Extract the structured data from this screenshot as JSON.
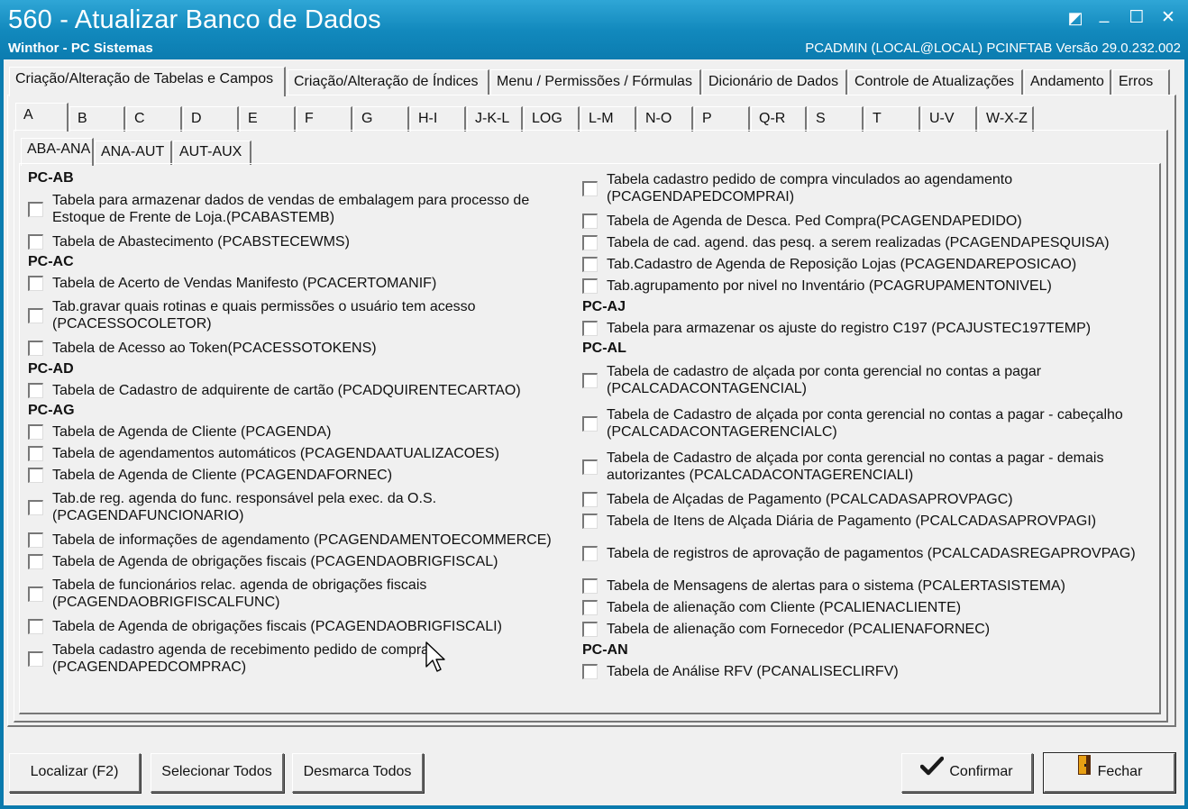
{
  "window": {
    "title": "560 - Atualizar Banco de Dados",
    "subtitle": "Winthor - PC Sistemas",
    "info": "PCADMIN (LOCAL@LOCAL)  PCINFTAB  Versão  29.0.232.002",
    "btn_min": "_",
    "btn_max": "☐",
    "btn_close": "✕",
    "btn_restore": "◩"
  },
  "outer_tabs": [
    "Criação/Alteração de Tabelas e Campos",
    "Criação/Alteração de Índices",
    "Menu / Permissões / Fórmulas",
    "Dicionário de Dados",
    "Controle de Atualizações",
    "Andamento",
    "Erros"
  ],
  "letter_tabs": [
    "A",
    "B",
    "C",
    "D",
    "E",
    "F",
    "G",
    "H-I",
    "J-K-L",
    "LOG",
    "L-M",
    "N-O",
    "P",
    "Q-R",
    "S",
    "T",
    "U-V",
    "W-X-Z"
  ],
  "sub_tabs": [
    "ABA-ANA",
    "ANA-AUT",
    "AUT-AUX"
  ],
  "left": {
    "g_ab": "PC-AB",
    "i1a": "Tabela para armazenar dados de vendas de embalagem para processo de",
    "i1b": "Estoque de Frente de Loja.(PCABASTEMB)",
    "i2": "Tabela de Abastecimento (PCABSTECEWMS)",
    "g_ac": "PC-AC",
    "i3": "Tabela de Acerto de Vendas Manifesto (PCACERTOMANIF)",
    "i4a": "Tab.gravar quais rotinas e quais permissões o usuário tem acesso",
    "i4b": "(PCACESSOCOLETOR)",
    "i5": "Tabela de Acesso ao Token(PCACESSOTOKENS)",
    "g_ad": "PC-AD",
    "i6": "Tabela de Cadastro de adquirente de cartão (PCADQUIRENTECARTAO)",
    "g_ag": "PC-AG",
    "i7": "Tabela  de Agenda de Cliente (PCAGENDA)",
    "i8": "Tabela de agendamentos automáticos (PCAGENDAATUALIZACOES)",
    "i9": "Tabela  de Agenda de Cliente (PCAGENDAFORNEC)",
    "i10a": "Tab.de reg. agenda do func. responsável pela exec. da O.S.",
    "i10b": "(PCAGENDAFUNCIONARIO)",
    "i11": "Tabela de informações de agendamento (PCAGENDAMENTOECOMMERCE)",
    "i12": "Tabela de Agenda de obrigações fiscais (PCAGENDAOBRIGFISCAL)",
    "i13a": "Tabela de funcionários relac. agenda de obrigações fiscais",
    "i13b": "(PCAGENDAOBRIGFISCALFUNC)",
    "i14": "Tabela de Agenda de obrigações fiscais (PCAGENDAOBRIGFISCALI)",
    "i15a": "Tabela cadastro agenda de recebimento pedido de compra",
    "i15b": "(PCAGENDAPEDCOMPRAC)"
  },
  "right": {
    "i1a": "Tabela cadastro pedido de compra vinculados ao agendamento",
    "i1b": "(PCAGENDAPEDCOMPRAI)",
    "i2": "Tabela  de Agenda de Desca. Ped Compra(PCAGENDAPEDIDO)",
    "i3": "Tabela de cad. agend. das pesq. a serem realizadas (PCAGENDAPESQUISA)",
    "i4": "Tab.Cadastro de Agenda de Reposição Lojas (PCAGENDAREPOSICAO)",
    "i5": "Tab.agrupamento por nivel no Inventário (PCAGRUPAMENTONIVEL)",
    "g_aj": "PC-AJ",
    "i6": "Tabela para armazenar os ajuste do registro C197 (PCAJUSTEC197TEMP)",
    "g_al": "PC-AL",
    "i7a": "Tabela de cadastro de alçada por conta gerencial no contas a pagar",
    "i7b": "(PCALCADACONTAGENCIAL)",
    "i8a": "Tabela de Cadastro de alçada por conta gerencial no contas a pagar - cabeçalho",
    "i8b": "(PCALCADACONTAGERENCIALC)",
    "i9a": "Tabela de Cadastro de alçada por conta gerencial no contas a pagar - demais",
    "i9b": "autorizantes (PCALCADACONTAGERENCIALI)",
    "i10": "Tabela de Alçadas de Pagamento (PCALCADASAPROVPAGC)",
    "i11": "Tabela de Itens de Alçada Diária de Pagamento (PCALCADASAPROVPAGI)",
    "i12": "Tabela de registros de aprovação de pagamentos (PCALCADASREGAPROVPAG)",
    "i13": "Tabela de Mensagens de alertas para o sistema (PCALERTASISTEMA)",
    "i14": "Tabela de alienação com Cliente (PCALIENACLIENTE)",
    "i15": "Tabela de alienação com Fornecedor (PCALIENAFORNEC)",
    "g_an": "PC-AN",
    "i16": "Tabela de Análise RFV (PCANALISECLIRFV)"
  },
  "buttons": {
    "localizar": "Localizar (F2)",
    "selecionar": "Selecionar Todos",
    "desmarca": "Desmarca Todos",
    "confirmar": "Confirmar",
    "fechar": "Fechar"
  }
}
